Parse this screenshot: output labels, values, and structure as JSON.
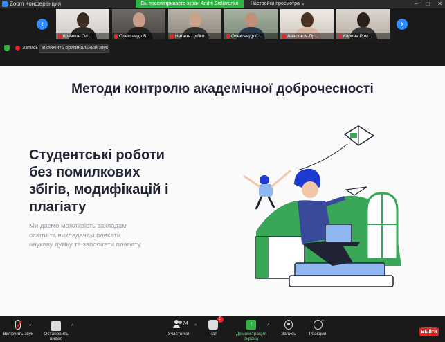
{
  "window": {
    "title": "Zoom Конференция",
    "viewing_banner": "Вы просматриваете экран Andrii Sidliarenko",
    "view_settings": "Настройки просмотра"
  },
  "gallery": {
    "participants": [
      {
        "name": "Кравець Ол...",
        "muted": true
      },
      {
        "name": "Олександр В...",
        "muted": true
      },
      {
        "name": "Наталя Цибко...",
        "muted": true
      },
      {
        "name": "Олександр С...",
        "muted": true
      },
      {
        "name": "Анастасія Пр...",
        "muted": true
      },
      {
        "name": "Карина Ром...",
        "muted": true
      }
    ]
  },
  "recording": {
    "label": "Запись",
    "original_sound": "Включить оригинальный звук"
  },
  "slide": {
    "title": "Методи контролю академічної доброчесності",
    "heading_lines": [
      "Студентські роботи",
      "без помилкових",
      "збігів, модифікацій і",
      "плагіату"
    ],
    "sub_lines": [
      "Ми даємо можливість закладам",
      "освіти та викладачам плекати",
      "наукову думку та запобігати плагіату"
    ]
  },
  "toolbar": {
    "unmute": "Включить звук",
    "start_video": "Остановить видео",
    "participants": "Участники",
    "participants_count": "74",
    "chat": "Чат",
    "chat_badge": "5",
    "share_screen": "Демонстрация экрана",
    "record": "Запись",
    "reactions": "Реакции",
    "leave": "Выйти"
  },
  "colors": {
    "accent_blue": "#2d8cff",
    "share_green": "#2fb344",
    "leave_red": "#e02828",
    "illus_navy": "#1f3ad1",
    "illus_green": "#3aa657"
  }
}
